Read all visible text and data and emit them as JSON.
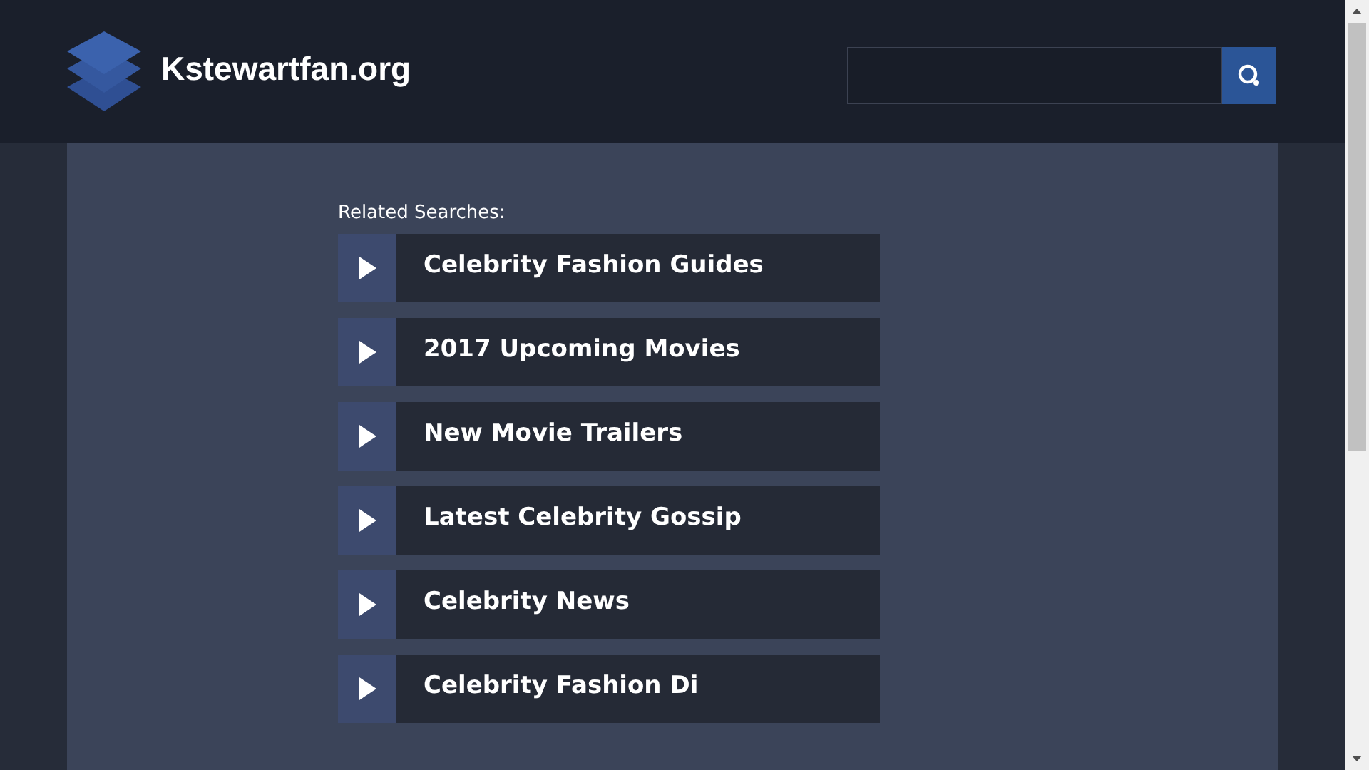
{
  "header": {
    "site_name": "Kstewartfan.org"
  },
  "related": {
    "heading": "Related Searches:",
    "items": [
      {
        "label": "Celebrity Fashion Guides"
      },
      {
        "label": "2017 Upcoming Movies"
      },
      {
        "label": "New Movie Trailers"
      },
      {
        "label": "Latest Celebrity Gossip"
      },
      {
        "label": "Celebrity News"
      },
      {
        "label": "Celebrity Fashion Di"
      }
    ]
  }
}
